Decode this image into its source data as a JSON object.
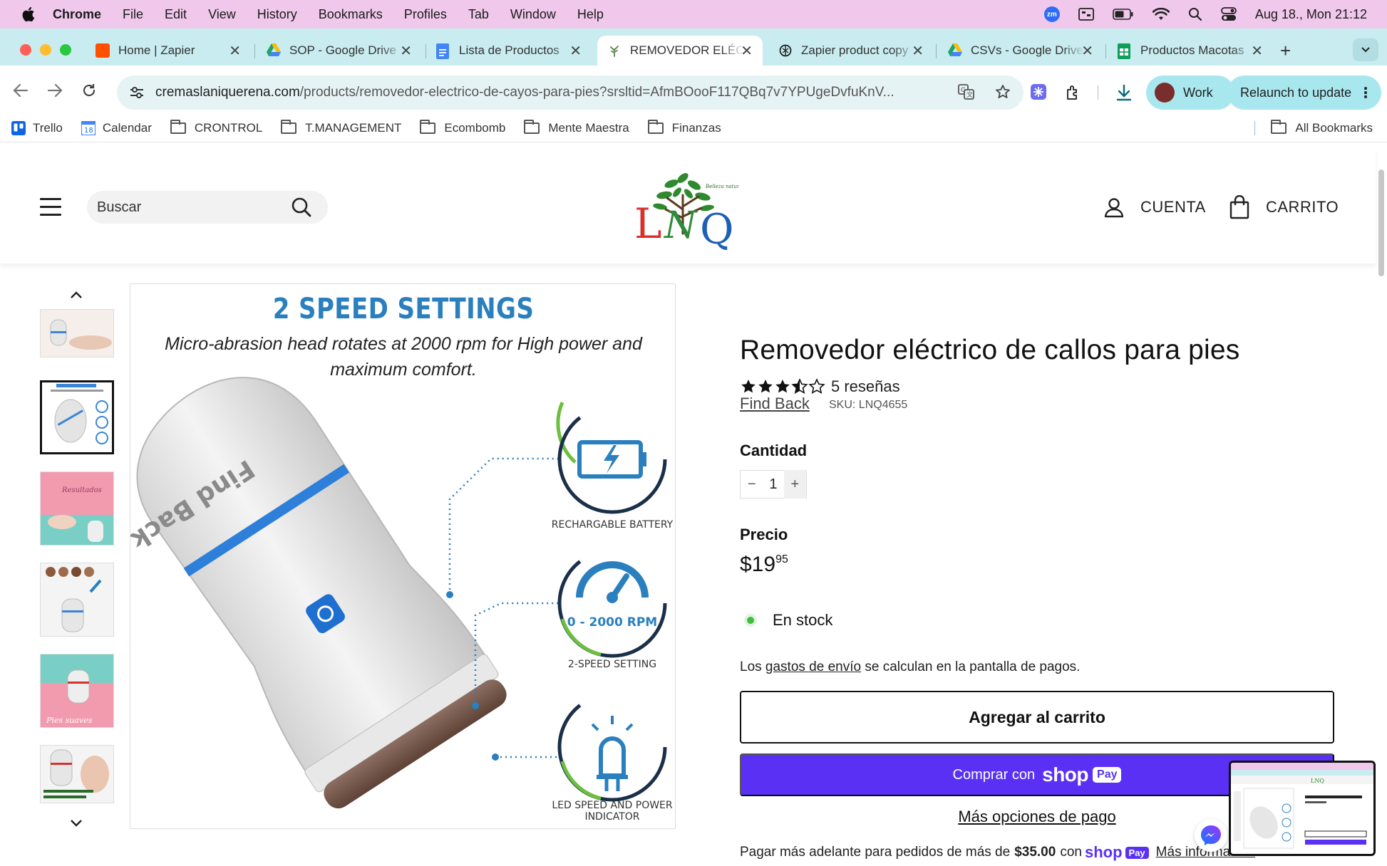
{
  "menubar": {
    "app": "Chrome",
    "items": [
      "File",
      "Edit",
      "View",
      "History",
      "Bookmarks",
      "Profiles",
      "Tab",
      "Window",
      "Help"
    ],
    "zoom_label": "zm",
    "datetime": "Aug 18., Mon  21:12"
  },
  "tabs": [
    {
      "label": "Home | Zapier",
      "favicon_color": "#ff4f00"
    },
    {
      "label": "SOP - Google Drive",
      "favicon_color": "#34a853"
    },
    {
      "label": "Lista de Productos",
      "favicon_color": "#4285f4"
    },
    {
      "label": "REMOVEDOR ELÉCTRICO",
      "favicon_color": "#6a8f5c"
    },
    {
      "label": "Zapier product copy",
      "favicon_color": "#333333"
    },
    {
      "label": "CSVs - Google Drive",
      "favicon_color": "#34a853"
    },
    {
      "label": "Productos Macotas",
      "favicon_color": "#0f9d58"
    }
  ],
  "toolbar": {
    "url_host": "cremaslaniquerena.com",
    "url_path": "/products/removedor-electrico-de-cayos-para-pies?srsltid=AfmBOooF117QBq7v7YPUgeDvfuKnV...",
    "profile_label": "Work",
    "relaunch_label": "Relaunch to update"
  },
  "bookmarks": {
    "items": [
      "Trello",
      "Calendar",
      "CRONTROL",
      "T.MANAGEMENT",
      "Ecombomb",
      "Mente Maestra",
      "Finanzas"
    ],
    "all_label": "All Bookmarks",
    "calendar_day": "18"
  },
  "site": {
    "search_placeholder": "Buscar",
    "logo_text": "LNQ",
    "logo_tagline": "Belleza natural",
    "account_label": "CUENTA",
    "cart_label": "CARRITO"
  },
  "image": {
    "headline": "2 SPEED SETTINGS",
    "subline": "Micro-abrasion head rotates at 2000 rpm for High power and maximum comfort.",
    "brand_on_device": "Find Back",
    "features": [
      {
        "label": "RECHARGABLE BATTERY",
        "icon": "battery-icon"
      },
      {
        "label": "2-SPEED SETTING",
        "icon": "gauge-icon",
        "inner": "0 - 2000 RPM"
      },
      {
        "label": "LED SPEED AND POWER INDICATOR",
        "icon": "led-icon"
      }
    ]
  },
  "product": {
    "title": "Removedor eléctrico de callos para pies",
    "rating": 3.5,
    "reviews_label": "5 reseñas",
    "vendor": "Find Back",
    "sku": "SKU: LNQ4655",
    "quantity_label": "Cantidad",
    "quantity": "1",
    "price_label": "Precio",
    "price_main": "$19",
    "price_cents": "95",
    "stock_label": "En stock",
    "shipping_pre": "Los ",
    "shipping_link": "gastos de envío",
    "shipping_post": " se calculan en la pantalla de pagos.",
    "add_to_cart": "Agregar al carrito",
    "buy_with": "Comprar con",
    "shop_brand": "shop",
    "pay_badge": "Pay",
    "more_options": "Más opciones de pago",
    "later_pre": "Pagar más adelante para pedidos de más de",
    "later_amount": "$35.00",
    "later_con": "con",
    "later_link": "Más información"
  },
  "colors": {
    "menubar": "#f0c8ec",
    "tabstrip": "#c8ecf0",
    "shoppay": "#5a31f4",
    "image_accent": "#2a7fbf",
    "stock_dot": "#3cbf3c"
  }
}
